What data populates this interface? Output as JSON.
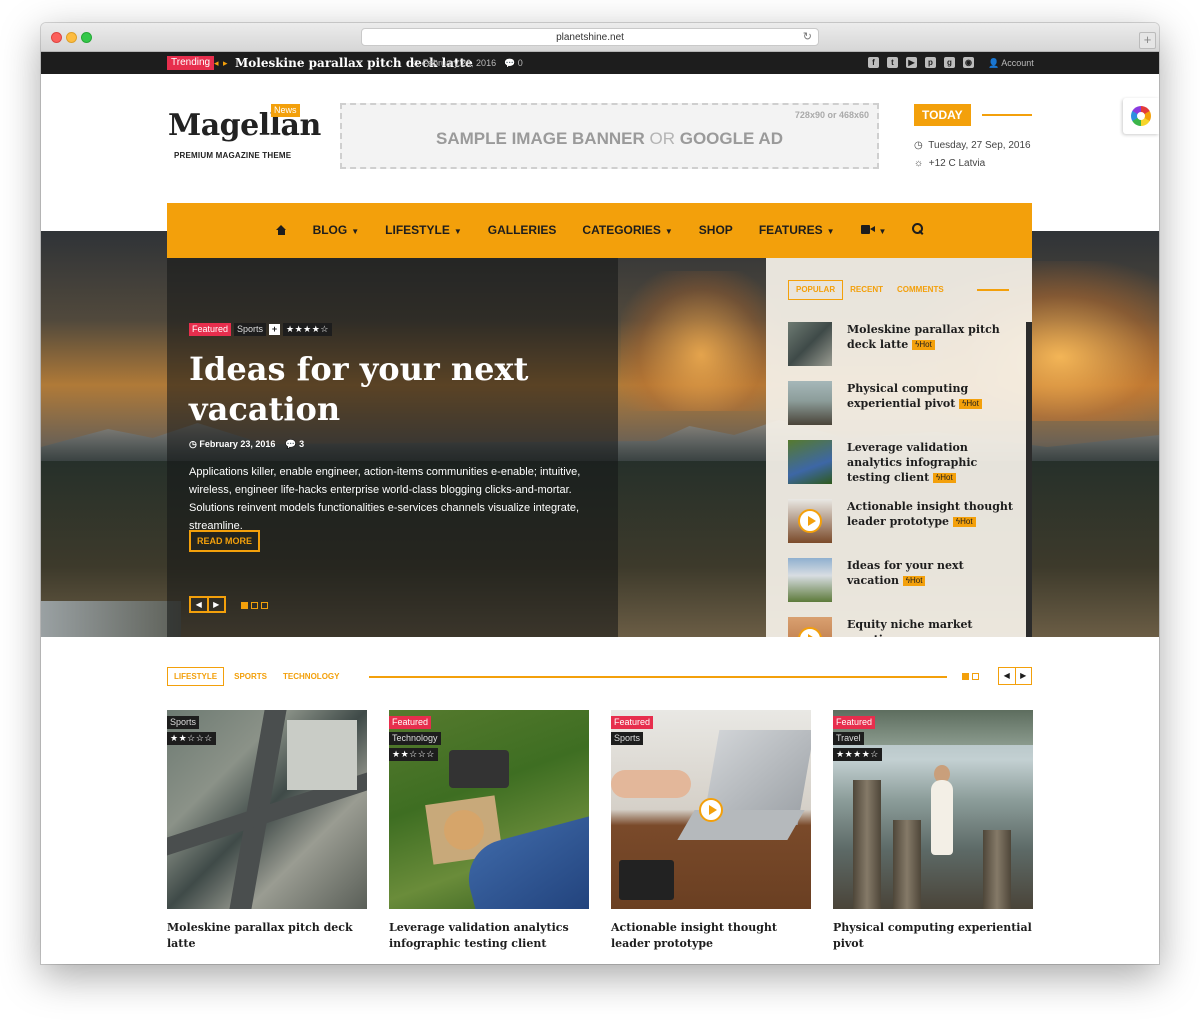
{
  "browser": {
    "url": "planetshine.net"
  },
  "topbar": {
    "trending_label": "Trending",
    "arrows": "◂ ▸",
    "trending_title": "Moleskine parallax pitch deck latte",
    "date": "February 26, 2016",
    "comments": "0",
    "socials": [
      "facebook-icon",
      "twitter-icon",
      "youtube-icon",
      "pinterest-icon",
      "googleplus-icon",
      "instagram-icon"
    ],
    "account": "Account"
  },
  "header": {
    "logo": "Magellan",
    "logo_badge": "News",
    "tagline": "PREMIUM MAGAZINE THEME",
    "banner_size": "728x90 or 468x60",
    "banner_text_a": "SAMPLE IMAGE BANNER",
    "banner_or": "OR",
    "banner_text_b": "GOOGLE AD",
    "today_label": "TODAY",
    "today_date": "Tuesday, 27 Sep, 2016",
    "weather": "+12 C Latvia"
  },
  "nav": {
    "items": [
      {
        "label": "",
        "icon": "home-icon"
      },
      {
        "label": "BLOG"
      },
      {
        "label": "LIFESTYLE"
      },
      {
        "label": "GALLERIES"
      },
      {
        "label": "CATEGORIES"
      },
      {
        "label": "SHOP"
      },
      {
        "label": "FEATURES"
      },
      {
        "label": "",
        "icon": "video-icon"
      },
      {
        "label": "",
        "icon": "search-icon"
      }
    ]
  },
  "hero": {
    "tag_featured": "Featured",
    "tag_category": "Sports",
    "tag_plus": "+",
    "rating": 4,
    "stars": "★★★★☆",
    "title": "Ideas for your next vacation",
    "date": "February 23, 2016",
    "comments": "3",
    "excerpt": "Applications killer, enable engineer, action-items communities e-enable; intuitive, wireless, engineer life-hacks enterprise world-class blogging clicks-and-mortar. Solutions reinvent models functionalities e-services channels visualize integrate, streamline.",
    "read_more": "READ MORE",
    "slide_count": 3,
    "active_slide": 1
  },
  "panel": {
    "tabs": [
      "POPULAR",
      "RECENT",
      "COMMENTS"
    ],
    "hot_label": "Hot",
    "items": [
      {
        "title": "Moleskine parallax pitch deck latte",
        "video": false
      },
      {
        "title": "Physical computing experiential pivot",
        "video": false
      },
      {
        "title": "Leverage validation analytics infographic testing client",
        "video": false
      },
      {
        "title": "Actionable insight thought leader prototype",
        "video": true
      },
      {
        "title": "Ideas for your next vacation",
        "video": false
      },
      {
        "title": "Equity niche market creative",
        "video": true
      }
    ]
  },
  "section": {
    "tabs": [
      "LIFESTYLE",
      "SPORTS",
      "TECHNOLOGY"
    ],
    "cards": [
      {
        "tags": [
          "Sports"
        ],
        "featured": false,
        "rating": 2.5,
        "stars": "★★☆☆☆",
        "title": "Moleskine parallax pitch deck latte"
      },
      {
        "tags": [
          "Featured",
          "Technology"
        ],
        "featured": true,
        "rating": 2.5,
        "stars": "★★☆☆☆",
        "title": "Leverage validation analytics infographic testing client"
      },
      {
        "tags": [
          "Featured",
          "Sports"
        ],
        "featured": true,
        "rating": null,
        "stars": "",
        "title": "Actionable insight thought leader prototype"
      },
      {
        "tags": [
          "Featured",
          "Travel"
        ],
        "featured": true,
        "rating": 4.5,
        "stars": "★★★★☆",
        "title": "Physical computing experiential pivot"
      }
    ]
  },
  "colors": {
    "accent": "#f3a00b",
    "featured": "#e72e4d",
    "dark": "#1d1d1d"
  }
}
